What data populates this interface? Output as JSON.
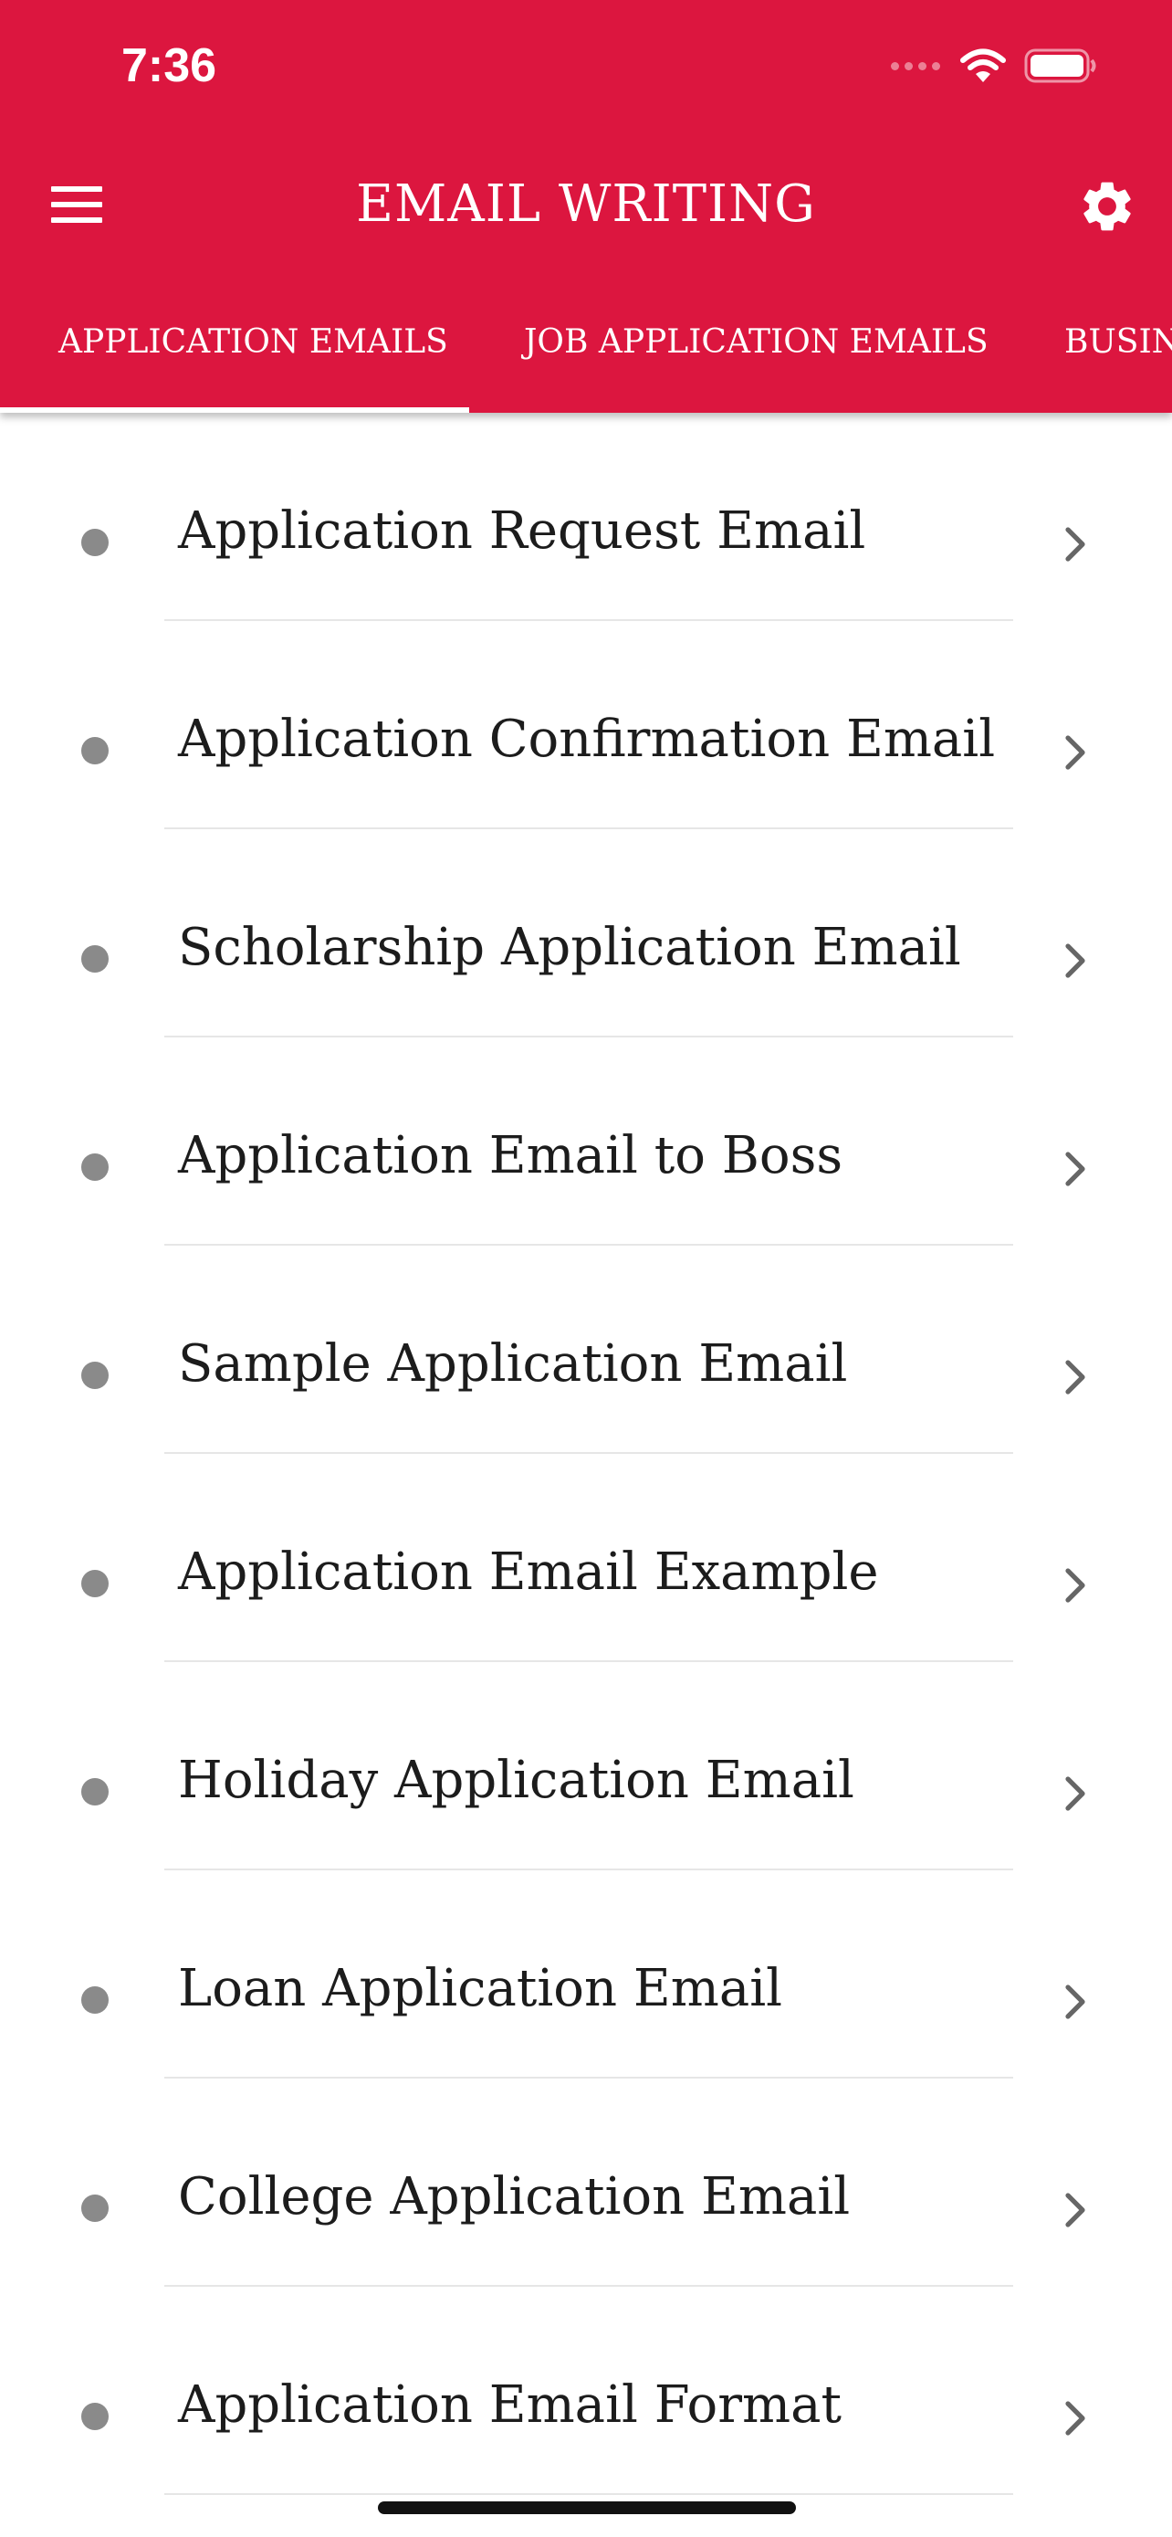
{
  "status_bar": {
    "time": "7:36",
    "icons": [
      "cellular-signal-icon",
      "wifi-icon",
      "battery-icon"
    ]
  },
  "header": {
    "title": "EMAIL WRITING",
    "left_icon": "menu-icon",
    "right_icon": "gear-icon"
  },
  "tabs": [
    {
      "label": "APPLICATION EMAILS",
      "selected": true
    },
    {
      "label": "JOB APPLICATION EMAILS",
      "selected": false
    },
    {
      "label": "BUSINESS EMAILS",
      "selected": false
    }
  ],
  "list": {
    "items": [
      {
        "label": "Application Request Email"
      },
      {
        "label": "Application Confirmation Email"
      },
      {
        "label": "Scholarship Application Email"
      },
      {
        "label": "Application Email to Boss"
      },
      {
        "label": "Sample Application Email"
      },
      {
        "label": "Application Email Example"
      },
      {
        "label": "Holiday Application Email"
      },
      {
        "label": "Loan Application Email"
      },
      {
        "label": "College Application Email"
      },
      {
        "label": "Application Email Format"
      }
    ]
  },
  "colors": {
    "primary": "#DC163F",
    "on_primary": "#FFFFFF",
    "bullet": "#8A8A8A",
    "text": "#1C1C1C",
    "divider": "#E6E6E6"
  }
}
